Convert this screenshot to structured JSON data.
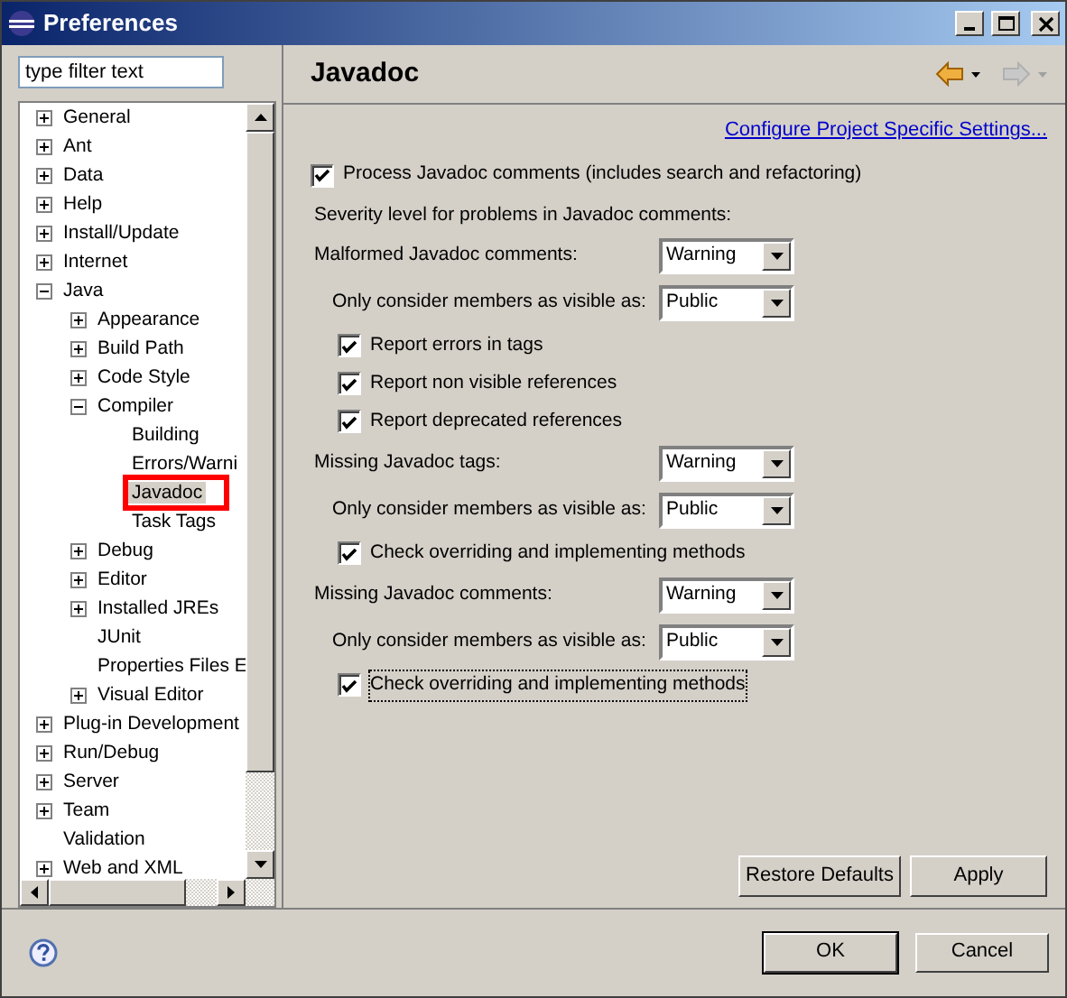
{
  "window": {
    "title": "Preferences"
  },
  "filter": {
    "value": "type filter text"
  },
  "tree": [
    {
      "label": "General",
      "expanded": false,
      "selected": false
    },
    {
      "label": "Ant",
      "expanded": false,
      "selected": false
    },
    {
      "label": "Data",
      "expanded": false,
      "selected": false
    },
    {
      "label": "Help",
      "expanded": false,
      "selected": false
    },
    {
      "label": "Install/Update",
      "expanded": false,
      "selected": false
    },
    {
      "label": "Internet",
      "expanded": false,
      "selected": false
    },
    {
      "label": "Java",
      "expanded": true,
      "selected": false,
      "children": [
        {
          "label": "Appearance",
          "expanded": false,
          "selected": false
        },
        {
          "label": "Build Path",
          "expanded": false,
          "selected": false
        },
        {
          "label": "Code Style",
          "expanded": false,
          "selected": false
        },
        {
          "label": "Compiler",
          "expanded": true,
          "selected": false,
          "children": [
            {
              "label": "Building",
              "selected": false
            },
            {
              "label": "Errors/Warni",
              "selected": false
            },
            {
              "label": "Javadoc",
              "selected": true,
              "highlighted": true
            },
            {
              "label": "Task Tags",
              "selected": false
            }
          ]
        },
        {
          "label": "Debug",
          "expanded": false,
          "selected": false
        },
        {
          "label": "Editor",
          "expanded": false,
          "selected": false
        },
        {
          "label": "Installed JREs",
          "expanded": false,
          "selected": false
        },
        {
          "label": "JUnit",
          "selected": false
        },
        {
          "label": "Properties Files E",
          "selected": false
        },
        {
          "label": "Visual Editor",
          "expanded": false,
          "selected": false
        }
      ]
    },
    {
      "label": "Plug-in Development",
      "expanded": false,
      "selected": false
    },
    {
      "label": "Run/Debug",
      "expanded": false,
      "selected": false
    },
    {
      "label": "Server",
      "expanded": false,
      "selected": false
    },
    {
      "label": "Team",
      "expanded": false,
      "selected": false
    },
    {
      "label": "Validation",
      "selected": false
    },
    {
      "label": "Web and XML",
      "expanded": false,
      "selected": false
    }
  ],
  "page": {
    "title": "Javadoc",
    "nav": {
      "back_enabled": true,
      "forward_enabled": false
    },
    "link": "Configure Project Specific Settings...",
    "process": {
      "label": "Process Javadoc comments (includes search and refactoring)",
      "checked": true
    },
    "severity_heading": "Severity level for problems in Javadoc comments:",
    "sections": [
      {
        "label": "Malformed Javadoc comments:",
        "value": "Warning",
        "visibility": {
          "label": "Only consider members as visible as:",
          "value": "Public"
        },
        "options": [
          {
            "label": "Report errors in tags",
            "checked": true,
            "focused": false
          },
          {
            "label": "Report non visible references",
            "checked": true,
            "focused": false
          },
          {
            "label": "Report deprecated references",
            "checked": true,
            "focused": false
          }
        ]
      },
      {
        "label": "Missing Javadoc tags:",
        "value": "Warning",
        "visibility": {
          "label": "Only consider members as visible as:",
          "value": "Public"
        },
        "options": [
          {
            "label": "Check overriding and implementing methods",
            "checked": true,
            "focused": false
          }
        ]
      },
      {
        "label": "Missing Javadoc comments:",
        "value": "Warning",
        "visibility": {
          "label": "Only consider members as visible as:",
          "value": "Public"
        },
        "options": [
          {
            "label": "Check overriding and implementing methods",
            "checked": true,
            "focused": true
          }
        ]
      }
    ],
    "buttons": [
      "Restore Defaults",
      "Apply"
    ]
  },
  "dialog_buttons": [
    {
      "label": "OK",
      "default": true
    },
    {
      "label": "Cancel",
      "default": false
    }
  ]
}
